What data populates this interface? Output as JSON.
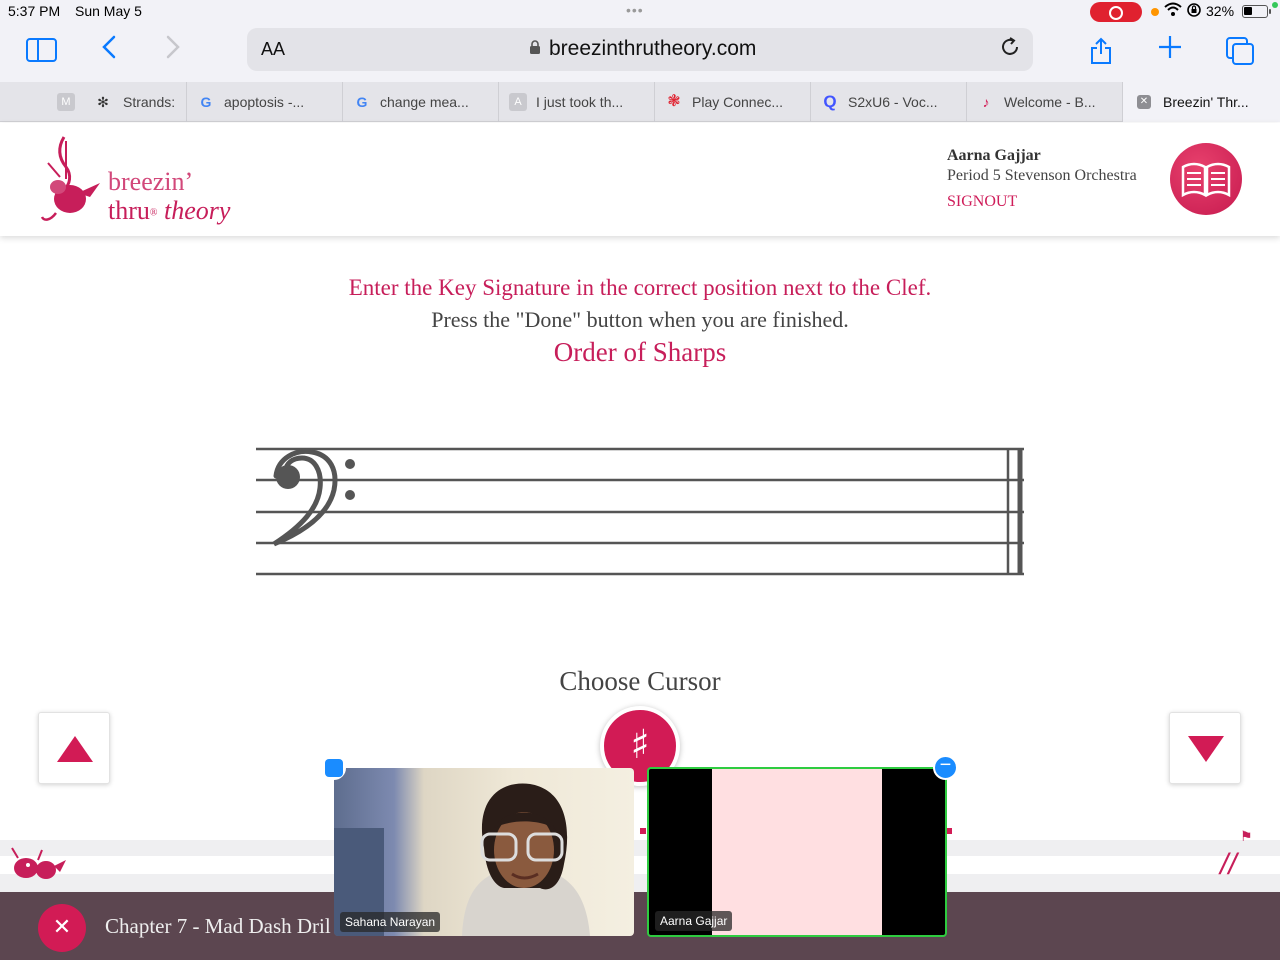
{
  "status_bar": {
    "time": "5:37 PM",
    "date": "Sun May 5",
    "battery": "32%"
  },
  "browser": {
    "text_size": "AA",
    "url": "breezinthrutheory.com",
    "tabs": [
      {
        "label": "M",
        "icon": "mail-icon"
      },
      {
        "label": "Strands:",
        "icon": "strands-icon"
      },
      {
        "label": "apoptosis -...",
        "icon": "google-icon"
      },
      {
        "label": "change mea...",
        "icon": "google-icon"
      },
      {
        "label": "I just took th...",
        "icon": "a-icon"
      },
      {
        "label": "Play Connec...",
        "icon": "cbc-icon"
      },
      {
        "label": "S2xU6 - Voc...",
        "icon": "quizlet-icon"
      },
      {
        "label": "Welcome - B...",
        "icon": "breezin-icon"
      },
      {
        "label": "Breezin' Thr...",
        "icon": "close-tab-icon"
      }
    ]
  },
  "header": {
    "logo_line1": "breezin’",
    "logo_line2a": "thru",
    "logo_reg": "®",
    "logo_line2b": "theory",
    "user_name": "Aarna Gajjar",
    "user_class": "Period 5 Stevenson Orchestra",
    "signout": "SIGNOUT"
  },
  "instructions": {
    "line1": "Enter the Key Signature in the correct position next to the Clef.",
    "line2": "Press the \"Done\" button when you are finished.",
    "line3": "Order of Sharps"
  },
  "exercise": {
    "clef": "bass-clef",
    "choose_cursor": "Choose Cursor",
    "cursor_symbol": "♯"
  },
  "footer": {
    "chapter_title": "Chapter 7 - Mad Dash Dril"
  },
  "video_call": {
    "participant1": "Sahana Narayan",
    "participant2": "Aarna Gajjar"
  },
  "colors": {
    "brand": "#d21b55",
    "brand_dark": "#c71e5a",
    "bottom_bar": "#5c4650",
    "accent_blue": "#0a7aff"
  }
}
